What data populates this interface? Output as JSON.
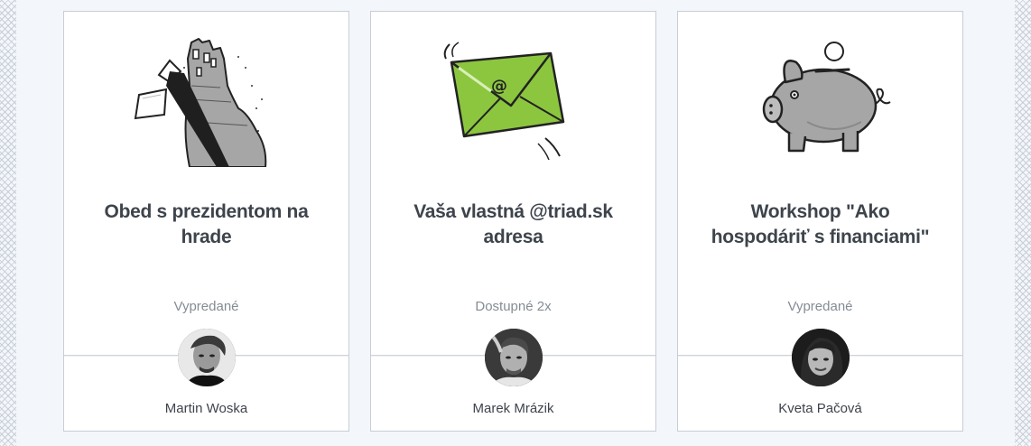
{
  "cards": [
    {
      "title": "Obed s prezidentom na hrade",
      "status": "Vypredané",
      "author": "Martin Woska",
      "icon": "castle-with-tie-icon"
    },
    {
      "title": "Vaša vlastná @triad.sk adresa",
      "status": "Dostupné 2x",
      "author": "Marek Mrázik",
      "icon": "envelope-icon",
      "accent": "#8cc63f"
    },
    {
      "title": "Workshop \"Ako hospodáriť s financiami\"",
      "status": "Vypredané",
      "author": "Kveta Pačová",
      "icon": "piggy-bank-icon"
    }
  ]
}
